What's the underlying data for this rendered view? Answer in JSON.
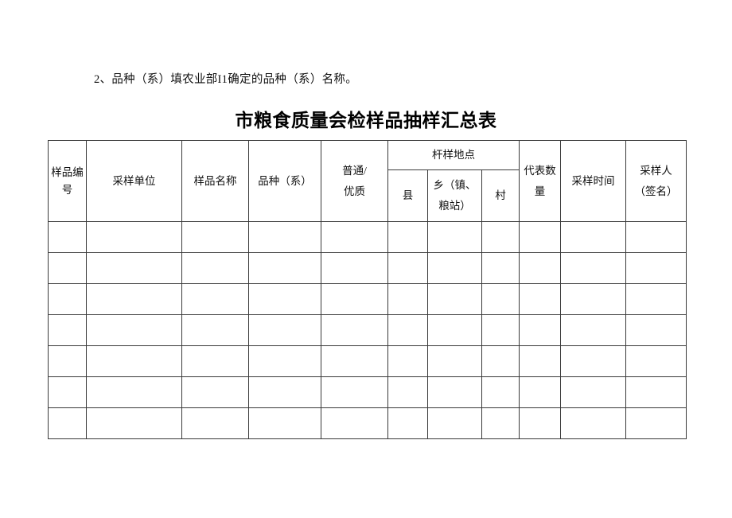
{
  "document": {
    "note": "2、品种（系）填农业部I1确定的品种（系）名称。",
    "title": "市粮食质量会检样品抽样汇总表"
  },
  "table": {
    "headers": {
      "sample_no": "样品编号",
      "sampling_unit": "采样单位",
      "sample_name": "样品名称",
      "variety": "品种（系）",
      "grade_line1": "普通/",
      "grade_line2": "优质",
      "location_group": "杆样地点",
      "county": "县",
      "town_line1": "乡（镇、",
      "town_line2": "粮站）",
      "village": "村",
      "quantity_line1": "代表数",
      "quantity_line2": "量",
      "sampling_time": "采样时间",
      "sampler_line1": "采样人",
      "sampler_line2": "（签名）"
    },
    "row_count": 7,
    "rows": [
      {
        "sample_no": "",
        "sampling_unit": "",
        "sample_name": "",
        "variety": "",
        "grade": "",
        "county": "",
        "town": "",
        "village": "",
        "quantity": "",
        "sampling_time": "",
        "sampler": ""
      },
      {
        "sample_no": "",
        "sampling_unit": "",
        "sample_name": "",
        "variety": "",
        "grade": "",
        "county": "",
        "town": "",
        "village": "",
        "quantity": "",
        "sampling_time": "",
        "sampler": ""
      },
      {
        "sample_no": "",
        "sampling_unit": "",
        "sample_name": "",
        "variety": "",
        "grade": "",
        "county": "",
        "town": "",
        "village": "",
        "quantity": "",
        "sampling_time": "",
        "sampler": ""
      },
      {
        "sample_no": "",
        "sampling_unit": "",
        "sample_name": "",
        "variety": "",
        "grade": "",
        "county": "",
        "town": "",
        "village": "",
        "quantity": "",
        "sampling_time": "",
        "sampler": ""
      },
      {
        "sample_no": "",
        "sampling_unit": "",
        "sample_name": "",
        "variety": "",
        "grade": "",
        "county": "",
        "town": "",
        "village": "",
        "quantity": "",
        "sampling_time": "",
        "sampler": ""
      },
      {
        "sample_no": "",
        "sampling_unit": "",
        "sample_name": "",
        "variety": "",
        "grade": "",
        "county": "",
        "town": "",
        "village": "",
        "quantity": "",
        "sampling_time": "",
        "sampler": ""
      },
      {
        "sample_no": "",
        "sampling_unit": "",
        "sample_name": "",
        "variety": "",
        "grade": "",
        "county": "",
        "town": "",
        "village": "",
        "quantity": "",
        "sampling_time": "",
        "sampler": ""
      }
    ]
  },
  "colors": {
    "page_background": "#ffffff",
    "text": "#111111",
    "table_border": "#3a3a3a"
  }
}
